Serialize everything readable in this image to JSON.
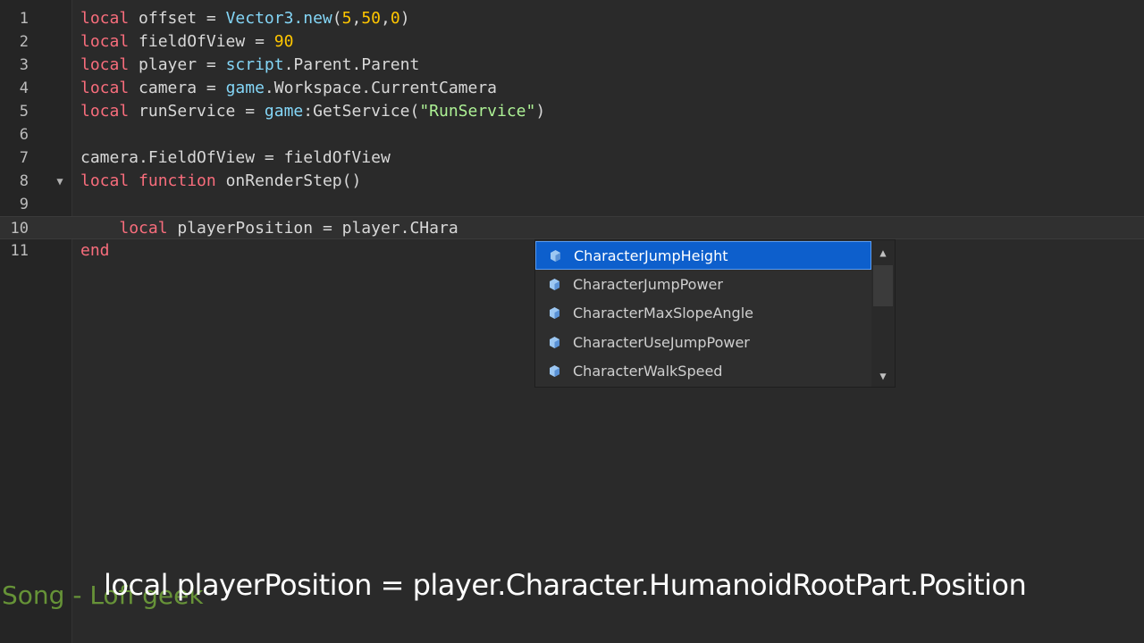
{
  "editor": {
    "lines": [
      {
        "num": "1",
        "tokens": [
          [
            "kw",
            "local"
          ],
          [
            "plain",
            " offset = "
          ],
          [
            "builtin",
            "Vector3.new"
          ],
          [
            "plain",
            "("
          ],
          [
            "num",
            "5"
          ],
          [
            "plain",
            ","
          ],
          [
            "num",
            "50"
          ],
          [
            "plain",
            ","
          ],
          [
            "num",
            "0"
          ],
          [
            "plain",
            ")"
          ]
        ]
      },
      {
        "num": "2",
        "tokens": [
          [
            "kw",
            "local"
          ],
          [
            "plain",
            " fieldOfView = "
          ],
          [
            "num",
            "90"
          ]
        ]
      },
      {
        "num": "3",
        "tokens": [
          [
            "kw",
            "local"
          ],
          [
            "plain",
            " player = "
          ],
          [
            "builtin",
            "script"
          ],
          [
            "plain",
            ".Parent.Parent"
          ]
        ]
      },
      {
        "num": "4",
        "tokens": [
          [
            "kw",
            "local"
          ],
          [
            "plain",
            " camera = "
          ],
          [
            "builtin",
            "game"
          ],
          [
            "plain",
            ".Workspace.CurrentCamera"
          ]
        ]
      },
      {
        "num": "5",
        "tokens": [
          [
            "kw",
            "local"
          ],
          [
            "plain",
            " runService = "
          ],
          [
            "builtin",
            "game"
          ],
          [
            "plain",
            ":GetService("
          ],
          [
            "str",
            "\"RunService\""
          ],
          [
            "plain",
            ")"
          ]
        ]
      },
      {
        "num": "6",
        "tokens": []
      },
      {
        "num": "7",
        "tokens": [
          [
            "plain",
            "camera.FieldOfView = fieldOfView"
          ]
        ]
      },
      {
        "num": "8",
        "tokens": [
          [
            "kw",
            "local"
          ],
          [
            "plain",
            " "
          ],
          [
            "kw",
            "function"
          ],
          [
            "plain",
            " onRenderStep()"
          ]
        ]
      },
      {
        "num": "9",
        "tokens": []
      },
      {
        "num": "10",
        "tokens": [
          [
            "plain",
            "    "
          ],
          [
            "kw",
            "local"
          ],
          [
            "plain",
            " playerPosition = player.CHara"
          ]
        ]
      },
      {
        "num": "11",
        "tokens": [
          [
            "kw",
            "end"
          ]
        ]
      }
    ]
  },
  "autocomplete": {
    "items": [
      {
        "label": "CharacterJumpHeight",
        "selected": true
      },
      {
        "label": "CharacterJumpPower",
        "selected": false
      },
      {
        "label": "CharacterMaxSlopeAngle",
        "selected": false
      },
      {
        "label": "CharacterUseJumpPower",
        "selected": false
      },
      {
        "label": "CharacterWalkSpeed",
        "selected": false
      }
    ],
    "item_icon": "property-icon",
    "scroll_up_icon": "triangle-up-icon",
    "scroll_down_icon": "triangle-down-icon"
  },
  "overlay": {
    "caption": "local playerPosition = player.Character.HumanoidRootPart.Position",
    "song": "Song - Lofi geek"
  },
  "colors": {
    "keyword": "#f86d7c",
    "builtin": "#84d6f7",
    "number": "#ffc600",
    "string": "#adf195",
    "selection": "#0d5fcc",
    "song_text": "#6e9f3a"
  }
}
